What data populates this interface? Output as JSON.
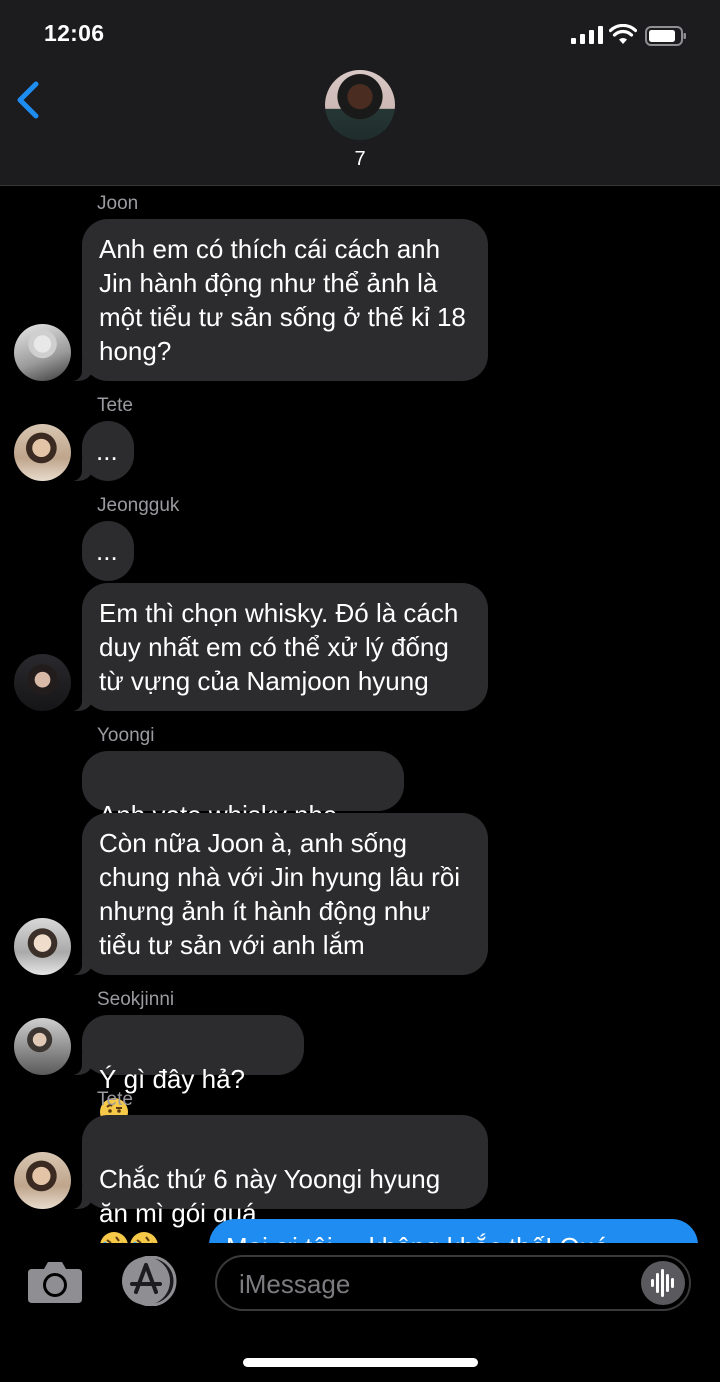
{
  "status": {
    "time": "12:06"
  },
  "header": {
    "group_name": "7"
  },
  "messages": [
    {
      "sender": "Joon",
      "text": "Anh em có thích cái cách anh\nJin hành động như thể ảnh là\nmột tiểu tư sản sống ở thế kỉ 18\nhong?"
    },
    {
      "sender": "Tete",
      "text": "..."
    },
    {
      "sender": "Jeongguk",
      "text": "..."
    },
    {
      "sender": "",
      "text": "Em thì chọn whisky. Đó là cách\nduy nhất em có thể xử lý đống\ntừ vựng của Namjoon hyung"
    },
    {
      "sender": "Yoongi",
      "text": "Anh vote whisky nha"
    },
    {
      "sender": "",
      "text": "Còn nữa Joon à, anh sống\nchung nhà với Jin hyung lâu rồi\nnhưng ảnh ít hành động như\ntiểu tư sản với anh lắm"
    },
    {
      "sender": "Seokjinni",
      "text": "Ý gì đây hả?"
    },
    {
      "sender": "Tete",
      "text": "Chắc thứ 6 này Yoongi hyung\năn mì gói quá"
    }
  ],
  "outgoing_partial": {
    "text": "Mai ơi tôi ... không khắc thế! Quá..."
  },
  "input": {
    "placeholder": "iMessage"
  },
  "icons": {
    "back": "chevron-left-icon",
    "camera": "camera-icon",
    "appstore": "app-store-icon",
    "audio": "audio-waveform-icon",
    "whisky": "tumbler-glass-emoji",
    "raised_eyebrow": "face-with-raised-eyebrow-emoji",
    "rofl": "rolling-on-floor-laughing-emoji"
  },
  "colors": {
    "accent": "#1e8cf0",
    "bubble": "#2c2c2e",
    "bar": "#1c1c1e"
  }
}
